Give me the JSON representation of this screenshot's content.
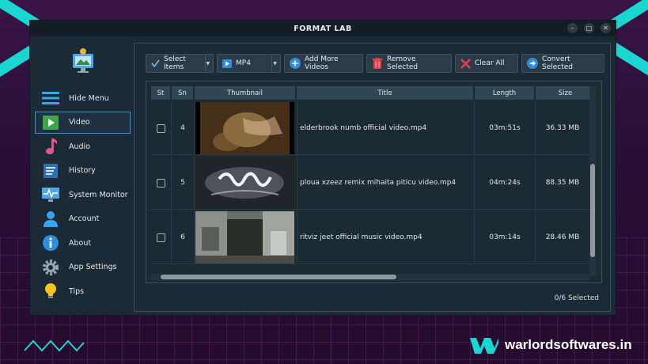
{
  "window": {
    "title": "FORMAT LAB"
  },
  "sidebar": {
    "items": [
      {
        "label": "Hide Menu",
        "icon": "menu-icon"
      },
      {
        "label": "Video",
        "icon": "video-icon",
        "active": true
      },
      {
        "label": "Audio",
        "icon": "music-note-icon"
      },
      {
        "label": "History",
        "icon": "history-icon"
      },
      {
        "label": "System Monitor",
        "icon": "monitor-icon"
      },
      {
        "label": "Account",
        "icon": "user-icon"
      },
      {
        "label": "About",
        "icon": "info-icon"
      },
      {
        "label": "App Settings",
        "icon": "gear-icon"
      },
      {
        "label": "Tips",
        "icon": "bulb-icon"
      }
    ]
  },
  "toolbar": {
    "select_items": "Select Items",
    "format": "MP4",
    "add_more": "Add More Videos",
    "remove_selected": "Remove Selected",
    "clear_all": "Clear All",
    "convert_selected": "Convert Selected"
  },
  "table": {
    "columns": {
      "st": "St",
      "sn": "Sn",
      "thumbnail": "Thumbnail",
      "title": "Title",
      "length": "Length",
      "size": "Size"
    },
    "rows": [
      {
        "sn": "4",
        "title": "elderbrook numb official video.mp4",
        "length": "03m:51s",
        "size": "36.33 MB"
      },
      {
        "sn": "5",
        "title": "ploua xzeez remix mihaita piticu video.mp4",
        "length": "04m:24s",
        "size": "88.35 MB"
      },
      {
        "sn": "6",
        "title": "ritviz jeet official music video.mp4",
        "length": "03m:14s",
        "size": "28.46 MB"
      }
    ]
  },
  "status": {
    "selected": "0/6 Selected"
  },
  "watermark": {
    "text": "warlordsoftwares.in"
  },
  "colors": {
    "accent": "#3a8fd0",
    "teal": "#19d7d0",
    "bg": "#1b2a35"
  }
}
